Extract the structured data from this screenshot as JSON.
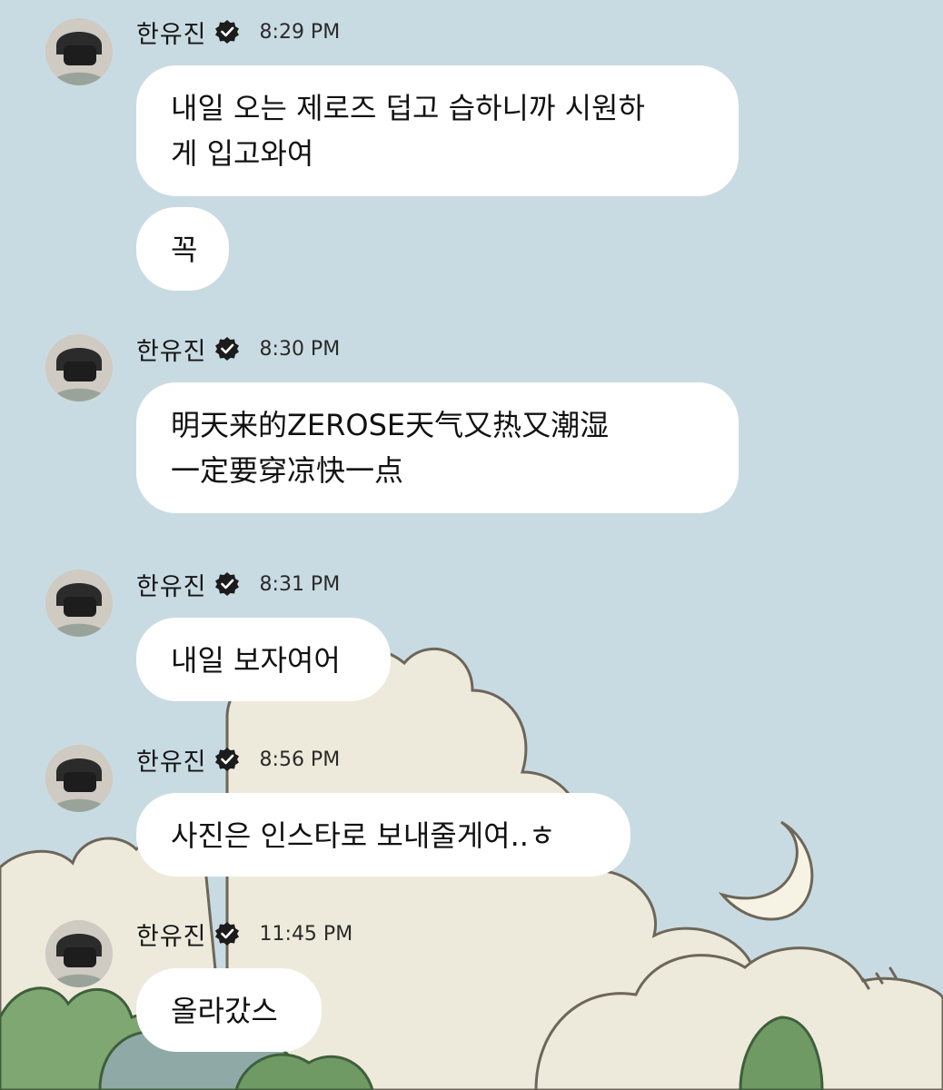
{
  "sender": {
    "name": "한유진",
    "verified_icon": "verified-badge-icon",
    "avatar": "profile-photo"
  },
  "messages": [
    {
      "time": "8:29 PM",
      "bubbles": [
        "내일 오는 제로즈 덥고 습하니까 시원하\n게 입고와여",
        "꼭"
      ]
    },
    {
      "time": "8:30 PM",
      "bubbles": [
        "明天来的ZEROSE天气又热又潮湿\n一定要穿凉快一点"
      ]
    },
    {
      "time": "8:31 PM",
      "bubbles": [
        "내일 보자여어"
      ]
    },
    {
      "time": "8:56 PM",
      "bubbles": [
        "사진은 인스타로 보내줄게여..ㅎ"
      ]
    },
    {
      "time": "11:45 PM",
      "bubbles": [
        "올라갔스"
      ]
    }
  ],
  "colors": {
    "background_sky": "#c9dbe2",
    "bubble": "#ffffff",
    "cloud": "#eeeadb",
    "tree": "#6f9a63"
  }
}
